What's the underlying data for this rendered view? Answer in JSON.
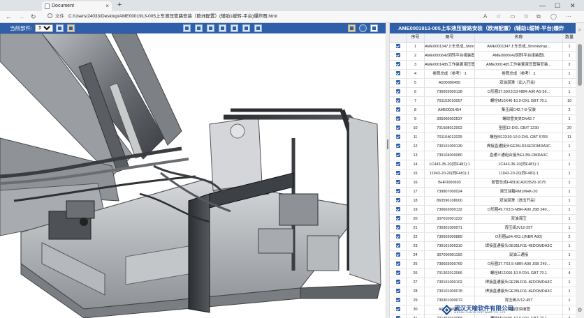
{
  "browser": {
    "tab_title": "Document",
    "tab_close": "×",
    "new_tab": "+",
    "nav_back": "←",
    "nav_forward": "→",
    "nav_reload": "↻",
    "addr_label": "文件",
    "url": "C:/Users/24033/Desktop/AME0001913-005上车液压管路安装（欧洲配置）(辅助1缓转-平台)爆炸图.html",
    "window_min": "—",
    "window_max": "☐",
    "window_close": "✕"
  },
  "viewer": {
    "step_label": "当前部件:",
    "step_value": "步骤1",
    "step_options": [
      "步骤1"
    ]
  },
  "bom": {
    "title": "AME0001913-005上车液压管路安装（欧洲配置）(辅助1缓转-平台)爆炸",
    "columns": [
      "",
      "序号",
      "图号",
      "名称",
      "数量"
    ],
    "rows": [
      [
        "1",
        "AME0001347上车总成_Shrinkwrap...",
        "AME0001347上车总成_Shrinkwrap...",
        "1"
      ],
      [
        "2",
        "AME0000642回转平台组装图1",
        "AME0000642回转平台组装图1",
        "1"
      ],
      [
        "3",
        "AME0001485工作装置液压管路安装...",
        "AME0001485工作装置液压管路安装...",
        "2"
      ],
      [
        "4",
        "卷筒总成（参考）:1",
        "卷筒总成（参考）:1",
        "1"
      ],
      [
        "5",
        "A000000495",
        "双油润滑（出入开关）",
        "1"
      ],
      [
        "6",
        "730603000138",
        "O形圈37.69X3.53-NBR-A90 AS 56...",
        "1"
      ],
      [
        "7",
        "701102010057",
        "螺栓M10X40-10.9-DXL GBT 70.1",
        "10"
      ],
      [
        "8",
        "AME0001454",
        "集压阀C42.7-8-安装",
        "2"
      ],
      [
        "9",
        "305060002537",
        "螺纹管夹夹DN42.7",
        "1"
      ],
      [
        "10",
        "701508012002",
        "垫圈12-DXL GB/T 1230",
        "20"
      ],
      [
        "11",
        "701104012025",
        "螺栓M12X30-10.9-DXL GBT 5783",
        "11"
      ],
      [
        "12",
        "730101000139",
        "焊接直通接头GE35LR16EDOMDA3C",
        "1"
      ],
      [
        "13",
        "730104000080",
        "直通三通组合接头EL35LOMDA3C",
        "1"
      ],
      [
        "14",
        "1C443-35-20(同F481):1",
        "1C443-35-20(同F481):1",
        "1"
      ],
      [
        "15",
        "11943-20-20(同F481):1",
        "11943-20-20(同F481):1",
        "1"
      ],
      [
        "16",
        "BHF0000603",
        "胶管总成F4819CA203520-1075",
        "1"
      ],
      [
        "17",
        "739807000024",
        "液压油箱RM1MHK-20",
        "1"
      ],
      [
        "18",
        "863596108000",
        "双油润滑（进出开关）",
        "1"
      ],
      [
        "19",
        "730603000132",
        "O形圈49.7X3.5-NBR-A90 JSB 240...",
        "1"
      ],
      [
        "20",
        "307010001222",
        "双油液压",
        "1"
      ],
      [
        "21",
        "730301000071",
        "背压阀JV12-25T",
        "1"
      ],
      [
        "22",
        "730603000889",
        "O形圈φ54.4X3.1(NBR A90)",
        "2"
      ],
      [
        "23",
        "730101000310",
        "焊接直通接头GE35LR11-4EDOMDA3C",
        "1"
      ],
      [
        "24",
        "307090001192",
        "双油三通接",
        "1"
      ],
      [
        "25",
        "730603000769",
        "O形圈37.7X3.5-NBR-A90 JSB 240...",
        "1"
      ],
      [
        "26",
        "701302012066",
        "螺栓M12X60-10.9-DXL GBT 70.1",
        "4"
      ],
      [
        "27",
        "730101000102",
        "焊接直通接头GE28LR11-4EDOMDA3C",
        "1"
      ],
      [
        "28",
        "730101000078",
        "焊接直通接头GE35LR11-4EDOMDA3C",
        "1"
      ],
      [
        "29",
        "730301000072",
        "背压阀JV12-45T",
        "1"
      ],
      [
        "30",
        "A000000490",
        "油箱双油液管",
        "1"
      ],
      [
        "31",
        "701302010058",
        "螺栓M10X55-10.9-DXL GBT 70.1",
        "4"
      ]
    ]
  },
  "logo": {
    "cn": "武汉天喻软件有限公司",
    "en": "WUHAN TIANYU SOFTWARE CO.,LTD"
  }
}
